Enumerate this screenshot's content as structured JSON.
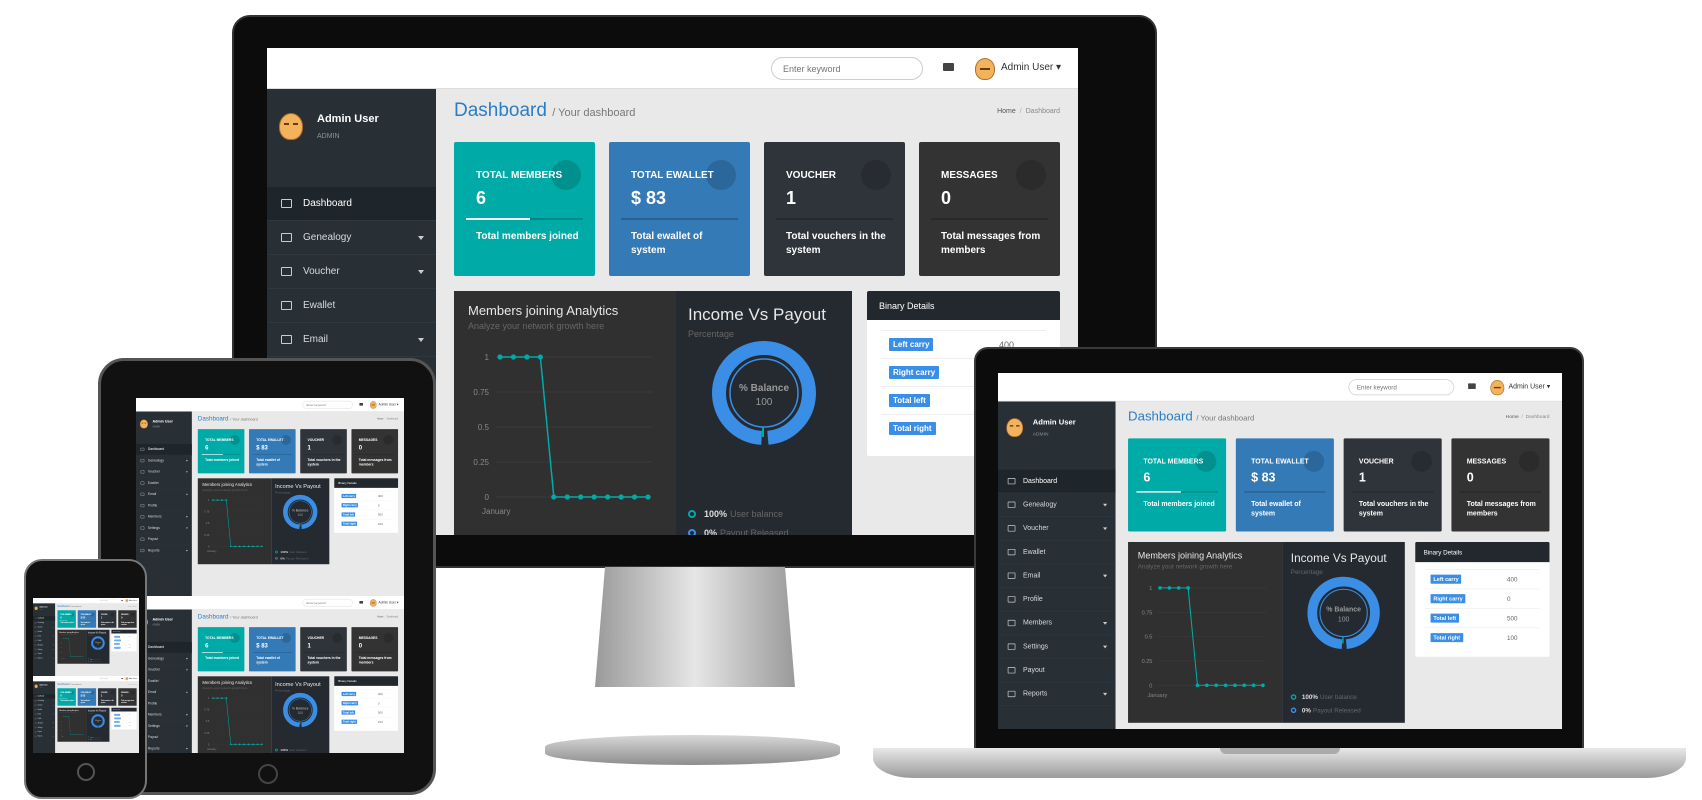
{
  "header": {
    "search_placeholder": "Enter keyword",
    "mail_icon": "envelope-icon",
    "user_name": "Admin User"
  },
  "sidebar": {
    "user_name": "Admin User",
    "role": "ADMIN",
    "items": [
      {
        "label": "Dashboard",
        "icon": "laptop-icon",
        "active": true,
        "dropdown": false
      },
      {
        "label": "Genealogy",
        "icon": "users-icon",
        "dropdown": true
      },
      {
        "label": "Voucher",
        "icon": "ticket-icon",
        "dropdown": true
      },
      {
        "label": "Ewallet",
        "icon": "credit-card-icon",
        "dropdown": false
      },
      {
        "label": "Email",
        "icon": "envelope-icon",
        "dropdown": true
      },
      {
        "label": "Profile",
        "icon": "id-card-icon",
        "dropdown": false
      },
      {
        "label": "Members",
        "icon": "user-icon",
        "dropdown": true
      },
      {
        "label": "Settings",
        "icon": "cogs-icon",
        "dropdown": true
      },
      {
        "label": "Payout",
        "icon": "money-icon",
        "dropdown": false
      },
      {
        "label": "Reports",
        "icon": "file-icon",
        "dropdown": true
      }
    ]
  },
  "page": {
    "title": "Dashboard",
    "subtitle": "/ Your dashboard",
    "breadcrumb": [
      "Home",
      "Dashboard"
    ]
  },
  "cards": [
    {
      "title": "Total Members",
      "value": "6",
      "desc": "Total members joined",
      "color": "#00aaa7",
      "icon": "globe-icon"
    },
    {
      "title": "Total Ewallet",
      "value": "$ 83",
      "desc": "Total ewallet of system",
      "color": "#337ab7",
      "icon": "tags-icon"
    },
    {
      "title": "Voucher",
      "value": "1",
      "desc": "Total vouchers in the system",
      "color": "#2f343a",
      "icon": "cart-icon"
    },
    {
      "title": "Messages",
      "value": "0",
      "desc": "Total messages from members",
      "color": "#333333",
      "icon": "comments-icon"
    }
  ],
  "analytics": {
    "title": "Members joining Analytics",
    "subtitle": "Analyze your network growth here"
  },
  "income": {
    "title": "Income Vs Payout",
    "subtitle": "Percentage",
    "center_label": "% Balance",
    "center_value": "100",
    "legend": [
      {
        "value": "100%",
        "label": "User balance",
        "color": "#00aaa7"
      },
      {
        "value": "0%",
        "label": "Payout Released",
        "color": "#3a8ee6"
      }
    ]
  },
  "binary": {
    "title": "Binary Details",
    "rows": [
      {
        "label": "Left carry",
        "value": "400"
      },
      {
        "label": "Right carry",
        "value": "0"
      },
      {
        "label": "Total left",
        "value": "500"
      },
      {
        "label": "Total right",
        "value": "100"
      }
    ]
  },
  "chart_data": {
    "type": "line",
    "xlabel": "January",
    "yticks": [
      "1",
      "0.75",
      "0.5",
      "0.25",
      "0"
    ],
    "ylim": [
      0,
      1
    ],
    "series": [
      {
        "values": [
          1,
          1,
          1,
          1,
          0,
          0,
          0,
          0,
          0,
          0,
          0,
          0
        ],
        "color": "#00aaa7"
      }
    ],
    "grid": true
  }
}
